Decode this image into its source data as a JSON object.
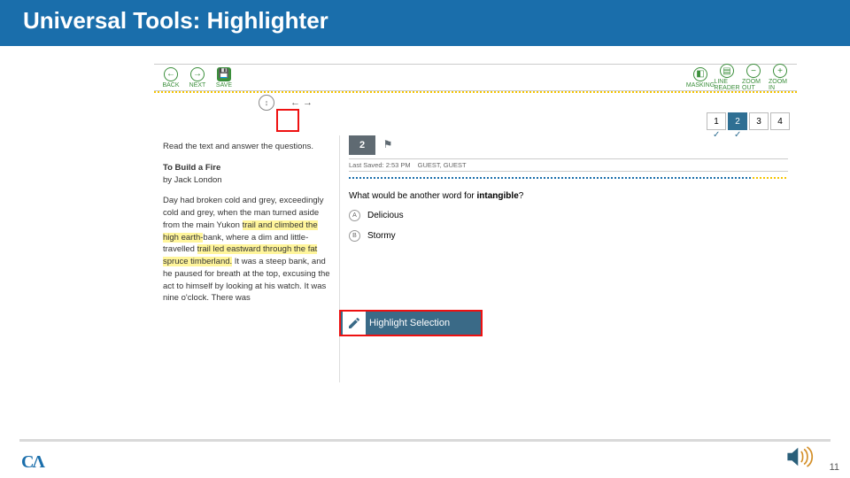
{
  "slide": {
    "title": "Universal Tools: Highlighter",
    "page_number": "11"
  },
  "toolbar": {
    "back": "BACK",
    "next": "NEXT",
    "save": "SAVE",
    "masking": "MASKING",
    "line_reader": "LINE READER",
    "zoom_out": "ZOOM OUT",
    "zoom_in": "ZOOM IN"
  },
  "pager": {
    "items": [
      "1",
      "2",
      "3",
      "4"
    ],
    "active_index": 1,
    "checked": [
      0,
      1
    ]
  },
  "passage": {
    "instruction": "Read the text and answer the questions.",
    "title": "To Build a Fire",
    "author": "by Jack London",
    "pre_text": "Day had broken cold and grey, exceedingly cold and grey, when the man turned aside from the main Yukon ",
    "hl1": "trail and climbed the high earth-",
    "mid1": "bank, where a dim and little-travelled ",
    "hl2": "trail led eastward through the fat spruce timberland.",
    "post_text": " It was a steep bank, and he paused for breath at the top, excusing the act to himself by looking at his watch. It was nine o'clock. There was"
  },
  "question": {
    "number": "2",
    "saved_time": "Last Saved: 2:53 PM",
    "user": "GUEST, GUEST",
    "stem_pre": "What would be another word for ",
    "stem_bold": "intangible",
    "stem_post": "?",
    "options": [
      {
        "letter": "A",
        "text": "Delicious"
      },
      {
        "letter": "B",
        "text": "Stormy"
      }
    ]
  },
  "context_menu": {
    "label": "Highlight Selection"
  }
}
